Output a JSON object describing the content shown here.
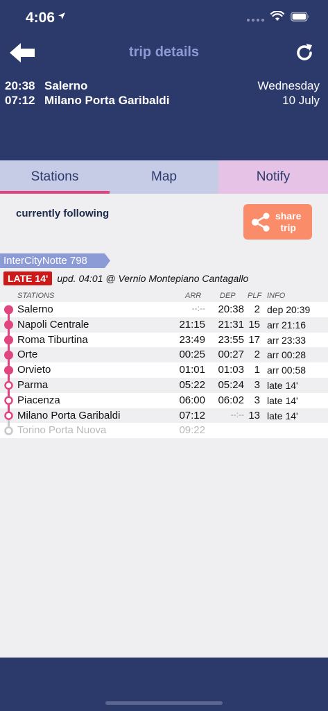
{
  "status_bar": {
    "time": "4:06"
  },
  "header": {
    "title": "trip details",
    "route": [
      {
        "time": "20:38",
        "station": "Salerno"
      },
      {
        "time": "07:12",
        "station": "Milano Porta Garibaldi"
      }
    ],
    "date": {
      "day": "Wednesday",
      "date": "10 July"
    }
  },
  "tabs": [
    {
      "label": "Stations",
      "active": true
    },
    {
      "label": "Map",
      "active": false
    },
    {
      "label": "Notify",
      "active": false
    }
  ],
  "following": {
    "label": "currently following",
    "share_label_1": "share",
    "share_label_2": "trip"
  },
  "train": {
    "name": "InterCityNotte 798",
    "late_badge": "LATE 14'",
    "update": "upd. 04:01 @ Vernio Montepiano Cantagallo"
  },
  "columns": {
    "stations": "STATIONS",
    "arr": "ARR",
    "dep": "DEP",
    "plf": "PLF",
    "info": "INFO"
  },
  "stops": [
    {
      "name": "Salerno",
      "arr": "--:--",
      "dep": "20:38",
      "plf": "2",
      "info": "dep 20:39"
    },
    {
      "name": "Napoli Centrale",
      "arr": "21:15",
      "dep": "21:31",
      "plf": "15",
      "info": "arr 21:16"
    },
    {
      "name": "Roma Tiburtina",
      "arr": "23:49",
      "dep": "23:55",
      "plf": "17",
      "info": "arr 23:33"
    },
    {
      "name": "Orte",
      "arr": "00:25",
      "dep": "00:27",
      "plf": "2",
      "info": "arr 00:28"
    },
    {
      "name": "Orvieto",
      "arr": "01:01",
      "dep": "01:03",
      "plf": "1",
      "info": "arr 00:58"
    },
    {
      "name": "Parma",
      "arr": "05:22",
      "dep": "05:24",
      "plf": "3",
      "info": "late 14'"
    },
    {
      "name": "Piacenza",
      "arr": "06:00",
      "dep": "06:02",
      "plf": "3",
      "info": "late 14'"
    },
    {
      "name": "Milano Porta Garibaldi",
      "arr": "07:12",
      "dep": "--:--",
      "plf": "13",
      "info": "late 14'"
    },
    {
      "name": "Torino Porta Nuova",
      "arr": "09:22",
      "dep": "",
      "plf": "",
      "info": ""
    }
  ],
  "colors": {
    "header": "#2b3a6b",
    "accent_pink": "#e0457f",
    "share": "#fb8c6a",
    "late": "#cc1a1a",
    "train_badge": "#8c9bd6"
  }
}
